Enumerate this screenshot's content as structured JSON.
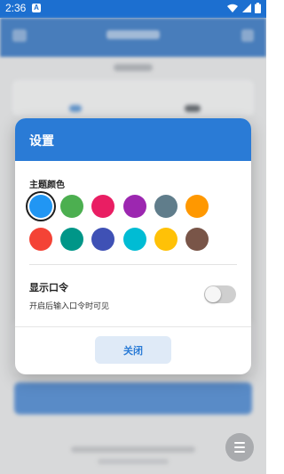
{
  "status_bar": {
    "time": "2:36",
    "app_icon_letter": "A"
  },
  "dialog": {
    "title": "设置",
    "theme_color_label": "主题颜色",
    "theme_colors": [
      {
        "name": "blue",
        "hex": "#2196f3",
        "selected": true
      },
      {
        "name": "green",
        "hex": "#4caf50",
        "selected": false
      },
      {
        "name": "pink",
        "hex": "#e91e63",
        "selected": false
      },
      {
        "name": "purple",
        "hex": "#9c27b0",
        "selected": false
      },
      {
        "name": "blue-grey",
        "hex": "#607d8b",
        "selected": false
      },
      {
        "name": "orange",
        "hex": "#ff9800",
        "selected": false
      },
      {
        "name": "red",
        "hex": "#f44336",
        "selected": false
      },
      {
        "name": "teal",
        "hex": "#009688",
        "selected": false
      },
      {
        "name": "indigo",
        "hex": "#3f51b5",
        "selected": false
      },
      {
        "name": "cyan",
        "hex": "#00bcd4",
        "selected": false
      },
      {
        "name": "amber",
        "hex": "#ffc107",
        "selected": false
      },
      {
        "name": "brown",
        "hex": "#795548",
        "selected": false
      }
    ],
    "password_label": "显示口令",
    "password_hint": "开启后输入口令时可见",
    "password_toggle_on": false,
    "close_label": "关闭"
  },
  "colors": {
    "accent": "#2a7bd6",
    "status_bar": "#1c6fd0"
  }
}
